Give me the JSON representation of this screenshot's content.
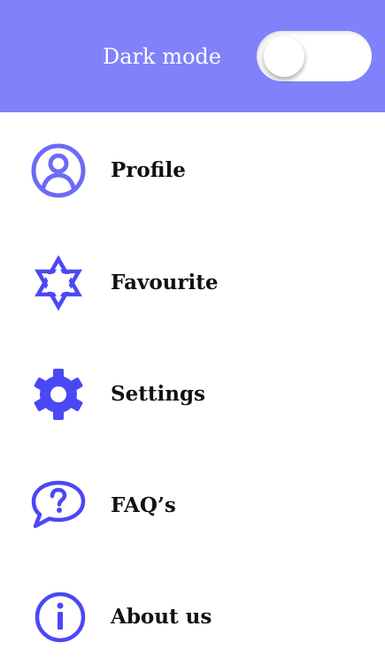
{
  "header": {
    "title": "Dark mode",
    "background_color": "#8181fb",
    "dark_mode_toggle": {
      "enabled": false
    }
  },
  "menu": {
    "accent_color": "#4a48f5",
    "items": [
      {
        "label": "Profile",
        "icon": "profile-icon"
      },
      {
        "label": "Favourite",
        "icon": "star-icon"
      },
      {
        "label": "Settings",
        "icon": "gear-icon"
      },
      {
        "label": "FAQ’s",
        "icon": "question-bubble-icon"
      },
      {
        "label": "About us",
        "icon": "info-icon"
      }
    ]
  }
}
